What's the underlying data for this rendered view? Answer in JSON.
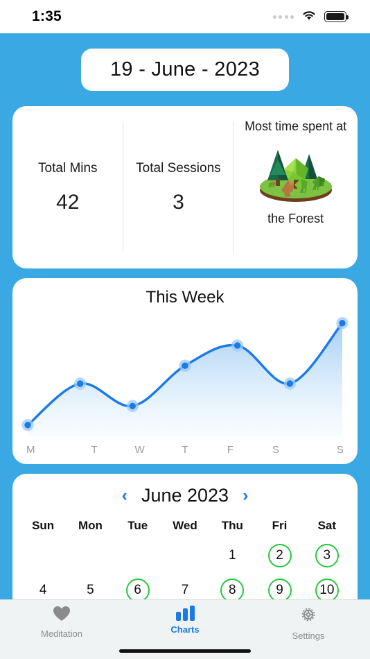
{
  "status_bar": {
    "time": "1:35",
    "signal_icon": "signal-dots-icon",
    "wifi_icon": "wifi-icon",
    "battery_icon": "battery-full-icon"
  },
  "theme": {
    "background": "#3aa9e3",
    "card": "#ffffff",
    "accent_blue": "#1a7ae8",
    "marked_green": "#25c83e",
    "muted_text": "#9b9b9b"
  },
  "date_header": {
    "label": "19 - June - 2023"
  },
  "stats": {
    "total_mins": {
      "label": "Total Mins",
      "value": "42"
    },
    "total_sessions": {
      "label": "Total Sessions",
      "value": "3"
    },
    "most_time": {
      "title": "Most time spent at",
      "caption": "the Forest",
      "icon": "forest-illustration"
    }
  },
  "chart_data": {
    "type": "line",
    "title": "This Week",
    "categories": [
      "M",
      "T",
      "W",
      "T",
      "F",
      "S",
      "S"
    ],
    "values": [
      5,
      42,
      22,
      58,
      76,
      42,
      96
    ],
    "xlabel": "",
    "ylabel": "",
    "ylim": [
      0,
      100
    ],
    "grid": false,
    "legend": false,
    "smooth": true,
    "area_fill": true,
    "line_color": "#1a7ae8",
    "point_color": "#1a7ae8",
    "point_halo_color": "#9ecbf5"
  },
  "calendar": {
    "title": "June 2023",
    "prev_label": "‹",
    "next_label": "›",
    "day_headers": [
      "Sun",
      "Mon",
      "Tue",
      "Wed",
      "Thu",
      "Fri",
      "Sat"
    ],
    "weeks": [
      [
        {
          "day": "",
          "marked": false
        },
        {
          "day": "",
          "marked": false
        },
        {
          "day": "",
          "marked": false
        },
        {
          "day": "",
          "marked": false
        },
        {
          "day": "1",
          "marked": false
        },
        {
          "day": "2",
          "marked": true
        },
        {
          "day": "3",
          "marked": true
        }
      ],
      [
        {
          "day": "4",
          "marked": false
        },
        {
          "day": "5",
          "marked": false
        },
        {
          "day": "6",
          "marked": true
        },
        {
          "day": "7",
          "marked": false
        },
        {
          "day": "8",
          "marked": true
        },
        {
          "day": "9",
          "marked": true
        },
        {
          "day": "10",
          "marked": true
        }
      ]
    ]
  },
  "tab_bar": {
    "tabs": [
      {
        "label": "Meditation",
        "icon": "heart-icon",
        "active": false
      },
      {
        "label": "Charts",
        "icon": "bar-chart-icon",
        "active": true
      },
      {
        "label": "Settings",
        "icon": "gear-icon",
        "active": false
      }
    ]
  }
}
